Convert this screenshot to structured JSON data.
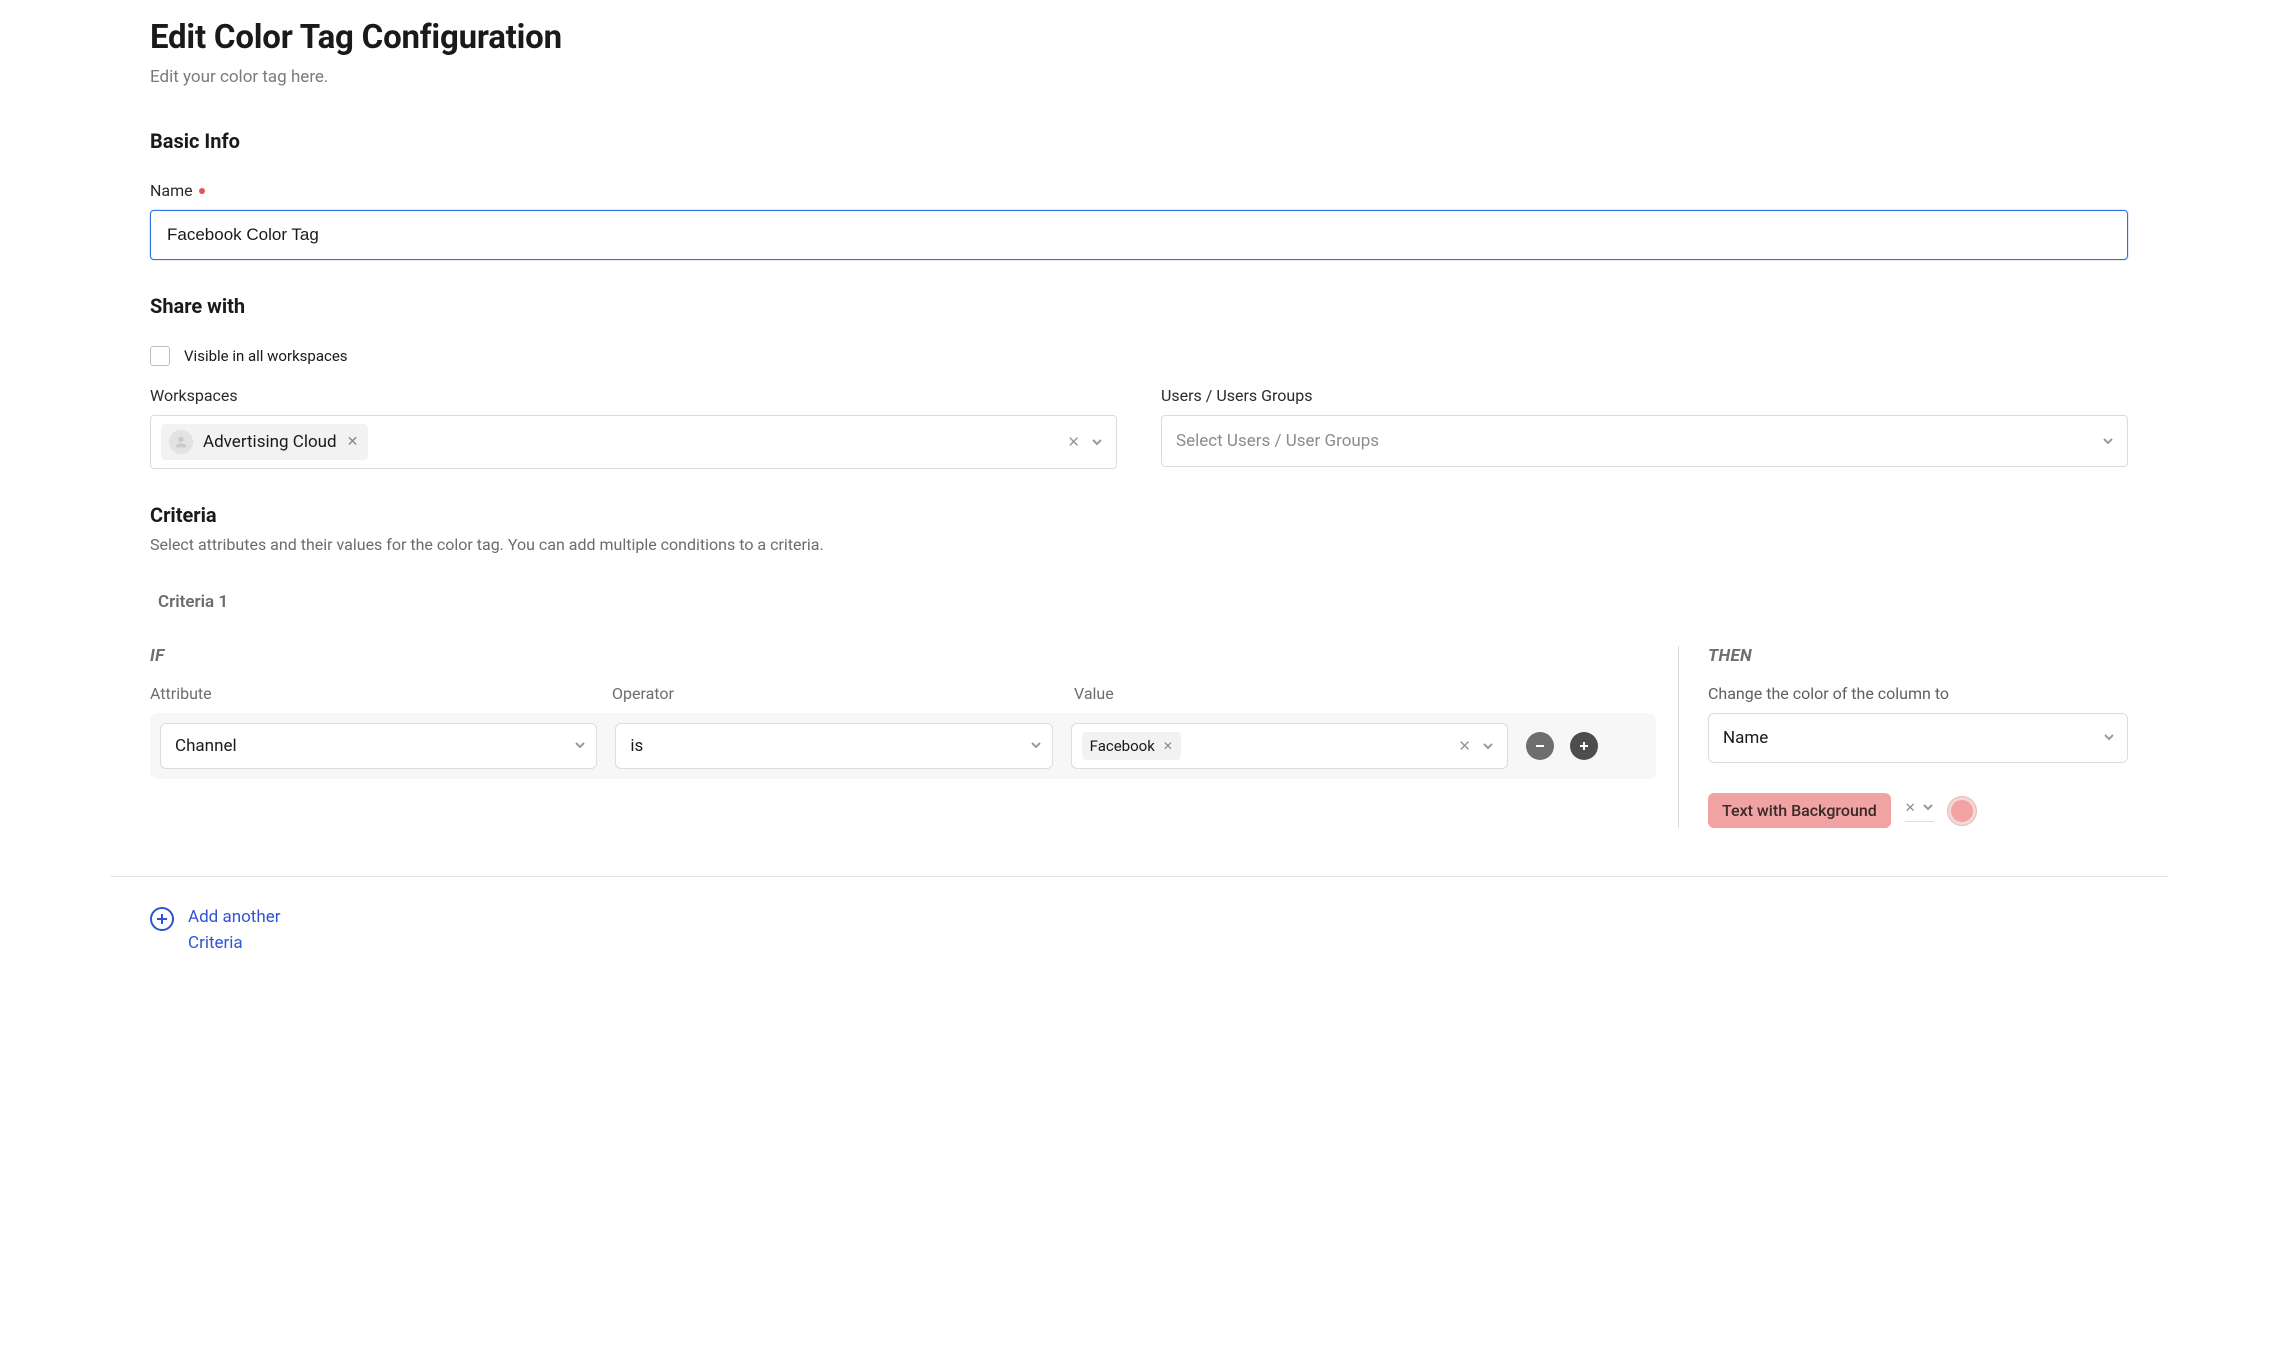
{
  "header": {
    "title": "Edit Color Tag Configuration",
    "subtitle": "Edit your color tag here."
  },
  "basic_info": {
    "heading": "Basic Info",
    "name_label": "Name",
    "name_value": "Facebook Color Tag"
  },
  "share_with": {
    "heading": "Share with",
    "visible_all_label": "Visible in all workspaces",
    "workspaces_label": "Workspaces",
    "workspace_chip": "Advertising Cloud",
    "users_label": "Users / Users Groups",
    "users_placeholder": "Select Users / User Groups"
  },
  "criteria": {
    "heading": "Criteria",
    "description": "Select attributes and their values for the color tag. You can add multiple conditions to a criteria.",
    "tab_label": "Criteria 1",
    "if_label": "IF",
    "then_label": "THEN",
    "columns": {
      "attribute": "Attribute",
      "operator": "Operator",
      "value": "Value"
    },
    "condition": {
      "attribute": "Channel",
      "operator": "is",
      "value_tag": "Facebook"
    },
    "then": {
      "change_label": "Change the color of the column to",
      "column_value": "Name",
      "style_label": "Text with Background",
      "swatch_color": "#f1a3a3"
    }
  },
  "footer": {
    "add_label": "Add another Criteria"
  }
}
